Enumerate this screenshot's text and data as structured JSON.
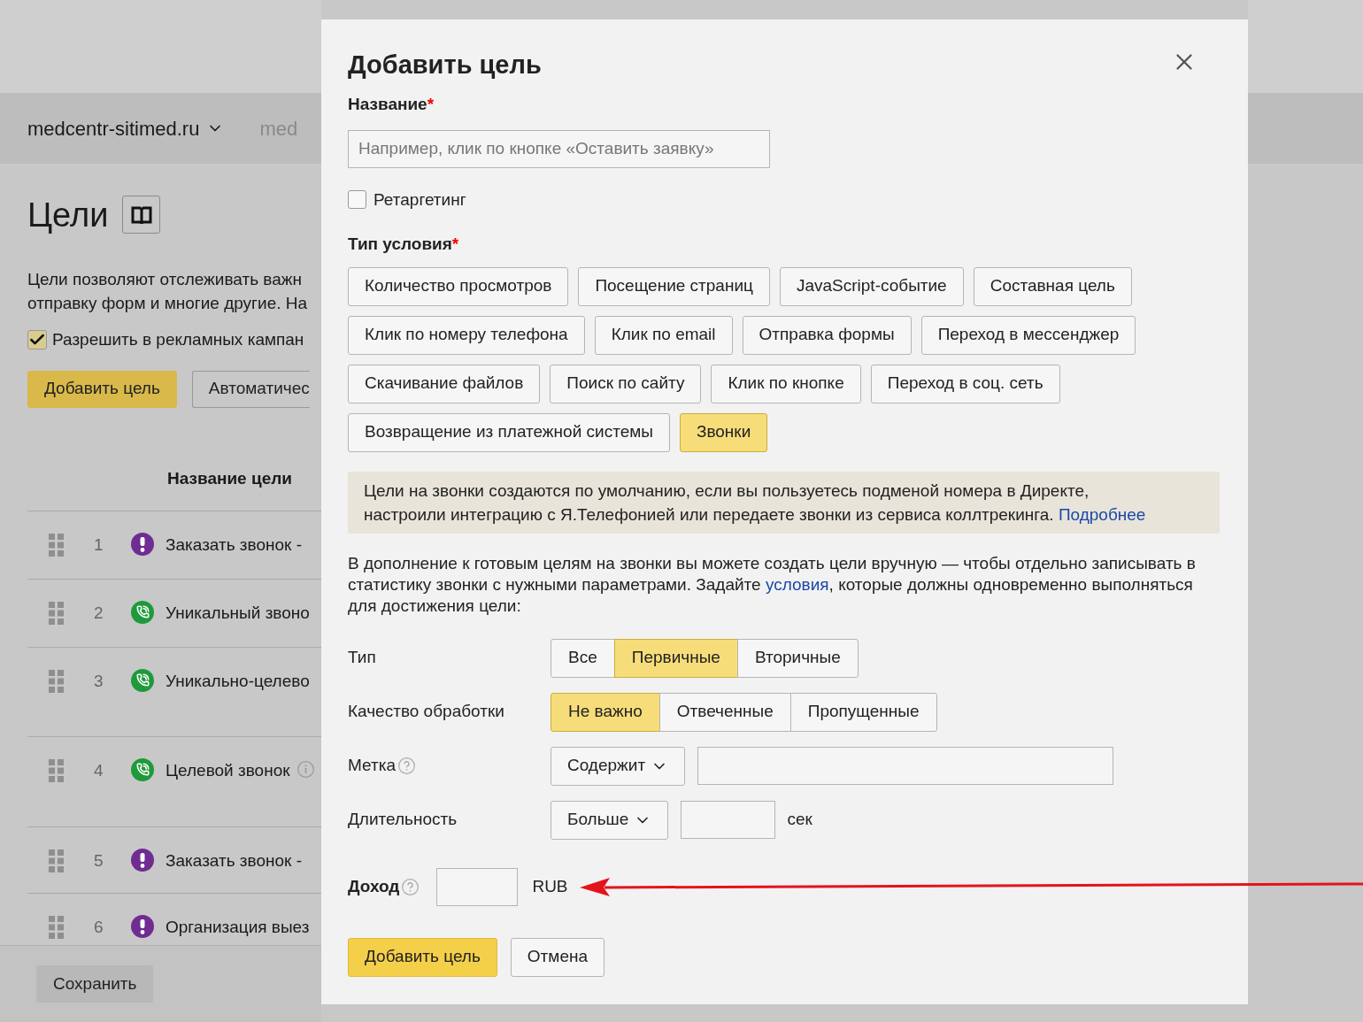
{
  "site_header": {
    "site": "medcentr-sitimed.ru",
    "site_2": "med"
  },
  "page": {
    "title": "Цели",
    "description": [
      "Цели позволяют отслеживать важн",
      "отправку форм и многие другие. На"
    ],
    "allow_checkbox": {
      "label": "Разрешить в рекламных кампан",
      "checked": true
    },
    "add_button": "Добавить цель",
    "auto_button": "Автоматичес",
    "column_header": "Название цели",
    "goals": [
      {
        "number": "1",
        "kind": "alert",
        "name": "Заказать звонок -"
      },
      {
        "number": "2",
        "kind": "call",
        "name": "Уникальный звоно"
      },
      {
        "number": "3",
        "kind": "call",
        "name": "Уникально-целево"
      },
      {
        "number": "4",
        "kind": "call",
        "name": "Целевой звонок",
        "info": true
      },
      {
        "number": "5",
        "kind": "alert",
        "name": "Заказать звонок -"
      },
      {
        "number": "6",
        "kind": "alert",
        "name": "Организация выез"
      }
    ],
    "save_button": "Сохранить"
  },
  "dialog": {
    "title": "Добавить цель",
    "name_label": "Название",
    "name_required": "*",
    "name_placeholder": "Например, клик по кнопке «Оставить заявку»",
    "retargeting": {
      "label": "Ретаргетинг",
      "checked": false
    },
    "condition_label": "Тип условия",
    "condition_required": "*",
    "condition_types": [
      [
        {
          "label": "Количество просмотров",
          "selected": false
        },
        {
          "label": "Посещение страниц",
          "selected": false
        },
        {
          "label": "JavaScript-событие",
          "selected": false
        },
        {
          "label": "Составная цель",
          "selected": false
        }
      ],
      [
        {
          "label": "Клик по номеру телефона",
          "selected": false
        },
        {
          "label": "Клик по email",
          "selected": false
        },
        {
          "label": "Отправка формы",
          "selected": false
        },
        {
          "label": "Переход в мессенджер",
          "selected": false
        }
      ],
      [
        {
          "label": "Скачивание файлов",
          "selected": false
        },
        {
          "label": "Поиск по сайту",
          "selected": false
        },
        {
          "label": "Клик по кнопке",
          "selected": false
        },
        {
          "label": "Переход в соц. сеть",
          "selected": false
        }
      ],
      [
        {
          "label": "Возвращение из платежной системы",
          "selected": false
        },
        {
          "label": "Звонки",
          "selected": true
        }
      ]
    ],
    "info": {
      "text": "Цели на звонки создаются по умолчанию, если вы пользуетесь подменой номера в Директе, настроили интеграцию с Я.Телефонией или передаете звонки из сервиса коллтрекинга.",
      "link": "Подробнее"
    },
    "manual": {
      "before": "В дополнение к готовым целям на звонки вы можете создать цели вручную — чтобы отдельно записывать в статистику звонки с нужными параметрами. Задайте",
      "link": "условия",
      "after": ", которые должны одновременно выполняться для достижения цели:"
    },
    "call_type": {
      "label": "Тип",
      "options": [
        {
          "label": "Все",
          "selected": false
        },
        {
          "label": "Первичные",
          "selected": true
        },
        {
          "label": "Вторичные",
          "selected": false
        }
      ]
    },
    "quality": {
      "label": "Качество обработки",
      "options": [
        {
          "label": "Не важно",
          "selected": true
        },
        {
          "label": "Отвеченные",
          "selected": false
        },
        {
          "label": "Пропущенные",
          "selected": false
        }
      ]
    },
    "tag": {
      "label": "Метка",
      "operator": "Содержит"
    },
    "duration": {
      "label": "Длительность",
      "operator": "Больше",
      "unit": "сек"
    },
    "revenue": {
      "label": "Доход",
      "currency": "RUB"
    },
    "submit_button": "Добавить цель",
    "cancel_button": "Отмена"
  }
}
